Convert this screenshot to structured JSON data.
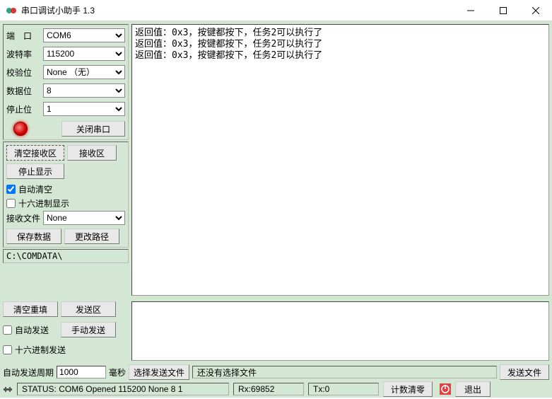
{
  "window": {
    "title": "串口调试小助手 1.3"
  },
  "port": {
    "port_label": "端　口",
    "port_value": "COM6",
    "baud_label": "波特率",
    "baud_value": "115200",
    "parity_label": "校验位",
    "parity_value": "None （无）",
    "data_label": "数据位",
    "data_value": "8",
    "stop_label": "停止位",
    "stop_value": "1",
    "close_btn": "关闭串口"
  },
  "recv": {
    "clear_btn": "清空接收区",
    "recv_area_btn": "接收区",
    "stop_btn": "停止显示",
    "auto_clear_label": "自动清空",
    "hex_label": "十六进制显示",
    "recv_file_label": "接收文件",
    "recv_file_value": "None",
    "save_btn": "保存数据",
    "change_path_btn": "更改路径",
    "path": "C:\\COMDATA\\"
  },
  "output_lines": [
    "返回值：0x3，按键都按下，任务2可以执行了",
    "返回值：0x3，按键都按下，任务2可以执行了",
    "返回值：0x3，按键都按下，任务2可以执行了"
  ],
  "send": {
    "clear_refill_btn": "清空重填",
    "send_area_btn": "发送区",
    "auto_send_label": "自动发送",
    "manual_send_btn": "手动发送",
    "hex_send_label": "十六进制发送",
    "period_label": "自动发送周期",
    "period_value": "1000",
    "period_unit": "毫秒",
    "choose_file_btn": "选择发送文件",
    "file_status": "还没有选择文件",
    "send_file_btn": "发送文件"
  },
  "status": {
    "status_text": "STATUS: COM6 Opened 115200 None  8 1",
    "rx": "Rx:69852",
    "tx": "Tx:0",
    "reset_count_btn": "计数清零",
    "exit_btn": "退出"
  }
}
